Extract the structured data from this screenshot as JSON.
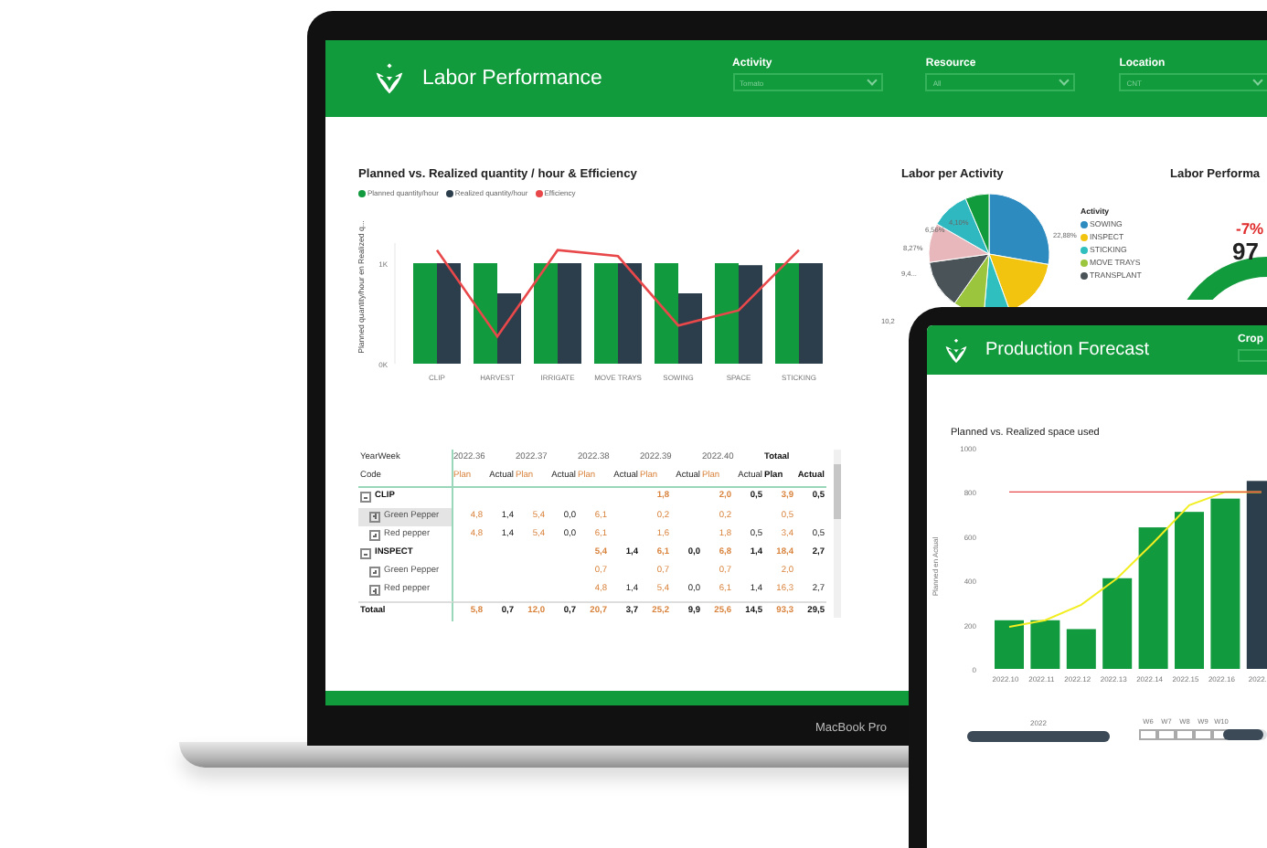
{
  "laptop": {
    "header": {
      "title": "Labor Performance",
      "filters": [
        {
          "label": "Activity",
          "value": "Tomato"
        },
        {
          "label": "Resource",
          "value": "All"
        },
        {
          "label": "Location",
          "value": "CNT"
        }
      ]
    },
    "quantity_chart": {
      "chart_data": {
        "type": "bar",
        "title": "Planned vs. Realized quantity / hour & Efficiency",
        "ylabel": "Planned quantity/hour en Realized q...",
        "categories": [
          "CLIP",
          "HARVEST",
          "IRRIGATE",
          "MOVE TRAYS",
          "SOWING",
          "SPACE",
          "STICKING"
        ],
        "series": [
          {
            "name": "Planned quantity/hour",
            "color": "#119a3e",
            "values": [
              1,
              1,
              1,
              1,
              1,
              1,
              1
            ]
          },
          {
            "name": "Realized quantity/hour",
            "color": "#2c3e4c",
            "values": [
              1,
              0.7,
              1,
              1,
              0.7,
              0.98,
              1
            ]
          },
          {
            "name": "Efficiency",
            "color": "#e8484a",
            "type": "line",
            "values": [
              1.13,
              0.27,
              1.13,
              1.07,
              0.38,
              0.53,
              1.13
            ]
          }
        ],
        "ylim": [
          0,
          1.2
        ],
        "yticks": [
          {
            "value": 0,
            "label": "0K"
          },
          {
            "value": 1,
            "label": "1K"
          }
        ]
      }
    },
    "table": {
      "year_week_label": "YearWeek",
      "weeks": [
        "2022.36",
        "2022.37",
        "2022.38",
        "2022.39",
        "2022.40",
        "Totaal"
      ],
      "code_label": "Code",
      "subheaders": [
        "Plan",
        "Actual",
        "Plan",
        "Actual",
        "Plan",
        "Actual",
        "Plan",
        "Actual",
        "Plan",
        "Actual",
        "Plan",
        "Actual"
      ],
      "rows": [
        {
          "label": "CLIP",
          "kind": "group",
          "expanded": true,
          "selected": false,
          "cells": [
            "",
            "",
            "",
            "",
            "",
            "",
            "1,8",
            "",
            "2,0",
            "0,5",
            "3,9",
            "0,5"
          ],
          "children": [
            {
              "label": "Green Pepper",
              "kind": "item",
              "expanded": false,
              "selected": true,
              "cells": [
                "4,8",
                "1,4",
                "5,4",
                "0,0",
                "6,1",
                "",
                "0,2",
                "",
                "0,2",
                "",
                "0,5",
                ""
              ]
            },
            {
              "label": "Red pepper",
              "kind": "item",
              "expanded": false,
              "selected": false,
              "cells": [
                "4,8",
                "1,4",
                "5,4",
                "0,0",
                "6,1",
                "",
                "1,6",
                "",
                "1,8",
                "0,5",
                "3,4",
                "0,5"
              ]
            }
          ]
        },
        {
          "label": "INSPECT",
          "kind": "group",
          "expanded": true,
          "selected": false,
          "cells": [
            "",
            "",
            "",
            "",
            "5,4",
            "1,4",
            "6,1",
            "0,0",
            "6,8",
            "1,4",
            "18,4",
            "2,7"
          ],
          "children": [
            {
              "label": "Green Pepper",
              "kind": "item",
              "expanded": false,
              "selected": false,
              "cells": [
                "",
                "",
                "",
                "",
                "0,7",
                "",
                "0,7",
                "",
                "0,7",
                "",
                "2,0",
                ""
              ]
            },
            {
              "label": "Red pepper",
              "kind": "item",
              "expanded": false,
              "selected": false,
              "cells": [
                "",
                "",
                "",
                "",
                "4,8",
                "1,4",
                "5,4",
                "0,0",
                "6,1",
                "1,4",
                "16,3",
                "2,7"
              ]
            }
          ]
        },
        {
          "label": "Totaal",
          "kind": "total",
          "selected": false,
          "cells": [
            "5,8",
            "0,7",
            "12,0",
            "0,7",
            "20,7",
            "3,7",
            "25,2",
            "9,9",
            "25,6",
            "14,5",
            "93,3",
            "29,5"
          ]
        }
      ]
    },
    "activity_pie": {
      "title": "Labor per Activity",
      "slice_labels": [
        "22,88%",
        "4,10%",
        "6,56%",
        "8,27%",
        "9,4...",
        "10,2"
      ],
      "legend_title": "Activity",
      "legend": [
        {
          "label": "SOWING",
          "color": "#2e8bc0"
        },
        {
          "label": "INSPECT",
          "color": "#f2c40f"
        },
        {
          "label": "STICKING",
          "color": "#2fbfbf"
        },
        {
          "label": "MOVE TRAYS",
          "color": "#9bc53d"
        },
        {
          "label": "TRANSPLANT",
          "color": "#4a5358"
        }
      ]
    },
    "gauge": {
      "title": "Labor Performa",
      "delta": "-7%",
      "value": "97"
    },
    "brand": "MacBook Pro"
  },
  "tablet": {
    "header": {
      "title": "Production Forecast",
      "filter_label": "Crop"
    },
    "chart_data": {
      "type": "bar",
      "title": "Planned vs. Realized space used",
      "ylabel": "Planned en Actual",
      "categories": [
        "2022.10",
        "2022.11",
        "2022.12",
        "2022.13",
        "2022.14",
        "2022.15",
        "2022.16",
        "2022."
      ],
      "series": [
        {
          "color": "#119a3e",
          "values": [
            220,
            220,
            180,
            410,
            640,
            710,
            770,
            null
          ]
        },
        {
          "color": "#2c3e4c",
          "values": [
            null,
            null,
            null,
            null,
            null,
            null,
            null,
            850
          ]
        },
        {
          "color": "#f2ee22",
          "type": "line",
          "values": [
            190,
            220,
            290,
            410,
            570,
            740,
            800,
            800
          ]
        },
        {
          "color": "#e8484a",
          "type": "line",
          "values": [
            800,
            800,
            800,
            800,
            800,
            800,
            800,
            800
          ]
        }
      ],
      "ylim": [
        0,
        1000
      ],
      "yticks": [
        0,
        200,
        400,
        600,
        800,
        1000
      ]
    },
    "timeline": {
      "year": "2022",
      "year_range": {
        "level": 1
      },
      "weeks": [
        "W6",
        "W7",
        "W8",
        "W9",
        "W10"
      ],
      "week_range": {
        "level": 0.9
      }
    }
  }
}
